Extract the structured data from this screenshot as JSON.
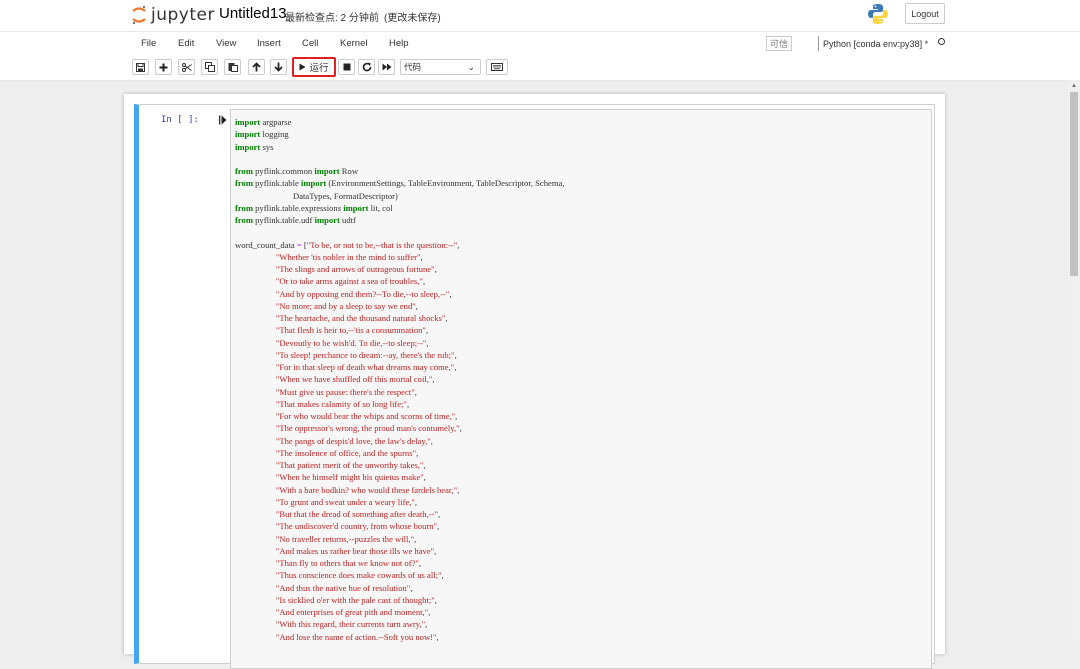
{
  "header": {
    "logo_text": "jupyter",
    "notebook_title": "Untitled13",
    "checkpoint_text": "最新检查点: 2 分钟前",
    "unsaved_text": "(更改未保存)",
    "logout_label": "Logout"
  },
  "menu": {
    "items": [
      "File",
      "Edit",
      "View",
      "Insert",
      "Cell",
      "Kernel",
      "Help"
    ],
    "trusted_label": "可信",
    "kernel_name": "Python [conda env:py38] *"
  },
  "toolbar": {
    "run_label": "运行",
    "cell_type_value": "代码"
  },
  "cell": {
    "prompt": "In [ ]:",
    "code_lines": [
      "import argparse",
      "import logging",
      "import sys",
      "",
      "from pyflink.common import Row",
      "from pyflink.table import (EnvironmentSettings, TableEnvironment, TableDescriptor, Schema,",
      "                           DataTypes, FormatDescriptor)",
      "from pyflink.table.expressions import lit, col",
      "from pyflink.table.udf import udtf",
      "",
      "word_count_data = [\"To be, or not to be,--that is the question:--\",",
      "                   \"Whether 'tis nobler in the mind to suffer\",",
      "                   \"The slings and arrows of outrageous fortune\",",
      "                   \"Or to take arms against a sea of troubles,\",",
      "                   \"And by opposing end them?--To die,--to sleep,--\",",
      "                   \"No more; and by a sleep to say we end\",",
      "                   \"The heartache, and the thousand natural shocks\",",
      "                   \"That flesh is heir to,--'tis a consummation\",",
      "                   \"Devoutly to be wish'd. To die,--to sleep;--\",",
      "                   \"To sleep! perchance to dream:--ay, there's the rub;\",",
      "                   \"For in that sleep of death what dreams may come,\",",
      "                   \"When we have shuffled off this mortal coil,\",",
      "                   \"Must give us pause: there's the respect\",",
      "                   \"That makes calamity of so long life;\",",
      "                   \"For who would bear the whips and scorns of time,\",",
      "                   \"The oppressor's wrong, the proud man's contumely,\",",
      "                   \"The pangs of despis'd love, the law's delay,\",",
      "                   \"The insolence of office, and the spurns\",",
      "                   \"That patient merit of the unworthy takes,\",",
      "                   \"When he himself might his quietus make\",",
      "                   \"With a bare bodkin? who would these fardels bear,\",",
      "                   \"To grunt and sweat under a weary life,\",",
      "                   \"But that the dread of something after death,--\",",
      "                   \"The undiscover'd country, from whose bourn\",",
      "                   \"No traveller returns,--puzzles the will,\",",
      "                   \"And makes us rather bear those ills we have\",",
      "                   \"Than fly to others that we know not of?\",",
      "                   \"Thus conscience does make cowards of us all;\",",
      "                   \"And thus the native hue of resolution\",",
      "                   \"Is sicklied o'er with the pale cast of thought;\",",
      "                   \"And enterprises of great pith and moment,\",",
      "                   \"With this regard, their currents turn awry,\",",
      "                   \"And lose the name of action.--Soft you now!\","
    ]
  }
}
